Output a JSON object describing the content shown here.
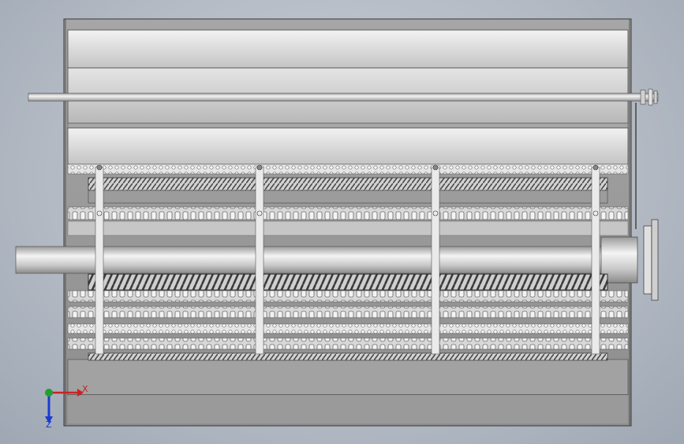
{
  "viewport": {
    "background_top": "#c9cfd7",
    "background_bottom": "#9ea7b3"
  },
  "model": {
    "description_kind": "cad-assembly",
    "housing_color": "#d7d7d7",
    "roller_color": "#bfbfbf",
    "chain_color": "#5a5a5a",
    "shaft_color": "#e6e6e6"
  },
  "triad": {
    "x_label": "X",
    "z_label": "Z",
    "x_color": "#d02020",
    "y_color": "#20a030",
    "z_color": "#1a3bd0"
  }
}
